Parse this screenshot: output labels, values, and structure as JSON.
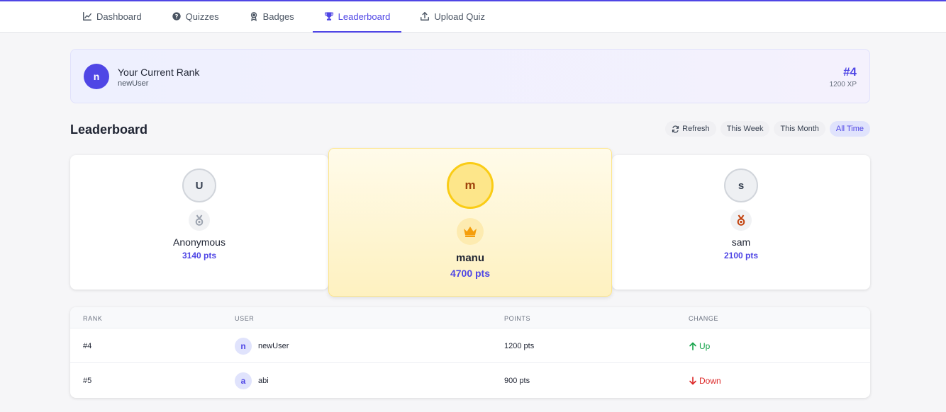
{
  "nav": {
    "items": [
      {
        "label": "Dashboard",
        "icon": "chart-line-icon",
        "active": false
      },
      {
        "label": "Quizzes",
        "icon": "question-circle-icon",
        "active": false
      },
      {
        "label": "Badges",
        "icon": "award-icon",
        "active": false
      },
      {
        "label": "Leaderboard",
        "icon": "trophy-icon",
        "active": true
      },
      {
        "label": "Upload Quiz",
        "icon": "upload-icon",
        "active": false
      }
    ]
  },
  "current_rank": {
    "avatar_letter": "n",
    "title": "Your Current Rank",
    "username": "newUser",
    "rank": "#4",
    "xp": "1200 XP"
  },
  "leaderboard": {
    "title": "Leaderboard",
    "refresh_label": "Refresh",
    "filters": [
      {
        "label": "This Week",
        "active": false
      },
      {
        "label": "This Month",
        "active": false
      },
      {
        "label": "All Time",
        "active": true
      }
    ]
  },
  "podium": {
    "second": {
      "avatar_letter": "U",
      "name": "Anonymous",
      "points": "3140 pts",
      "medal": "silver-medal-icon"
    },
    "first": {
      "avatar_letter": "m",
      "name": "manu",
      "points": "4700 pts",
      "medal": "crown-icon"
    },
    "third": {
      "avatar_letter": "s",
      "name": "sam",
      "points": "2100 pts",
      "medal": "bronze-medal-icon"
    }
  },
  "table": {
    "columns": [
      "RANK",
      "USER",
      "POINTS",
      "CHANGE"
    ],
    "rows": [
      {
        "rank": "#4",
        "avatar_letter": "n",
        "user": "newUser",
        "points": "1200 pts",
        "change": "Up"
      },
      {
        "rank": "#5",
        "avatar_letter": "a",
        "user": "abi",
        "points": "900 pts",
        "change": "Down"
      }
    ]
  },
  "colors": {
    "accent": "#4f46e5",
    "gold": "#facc15",
    "up": "#16a34a",
    "down": "#dc2626"
  }
}
